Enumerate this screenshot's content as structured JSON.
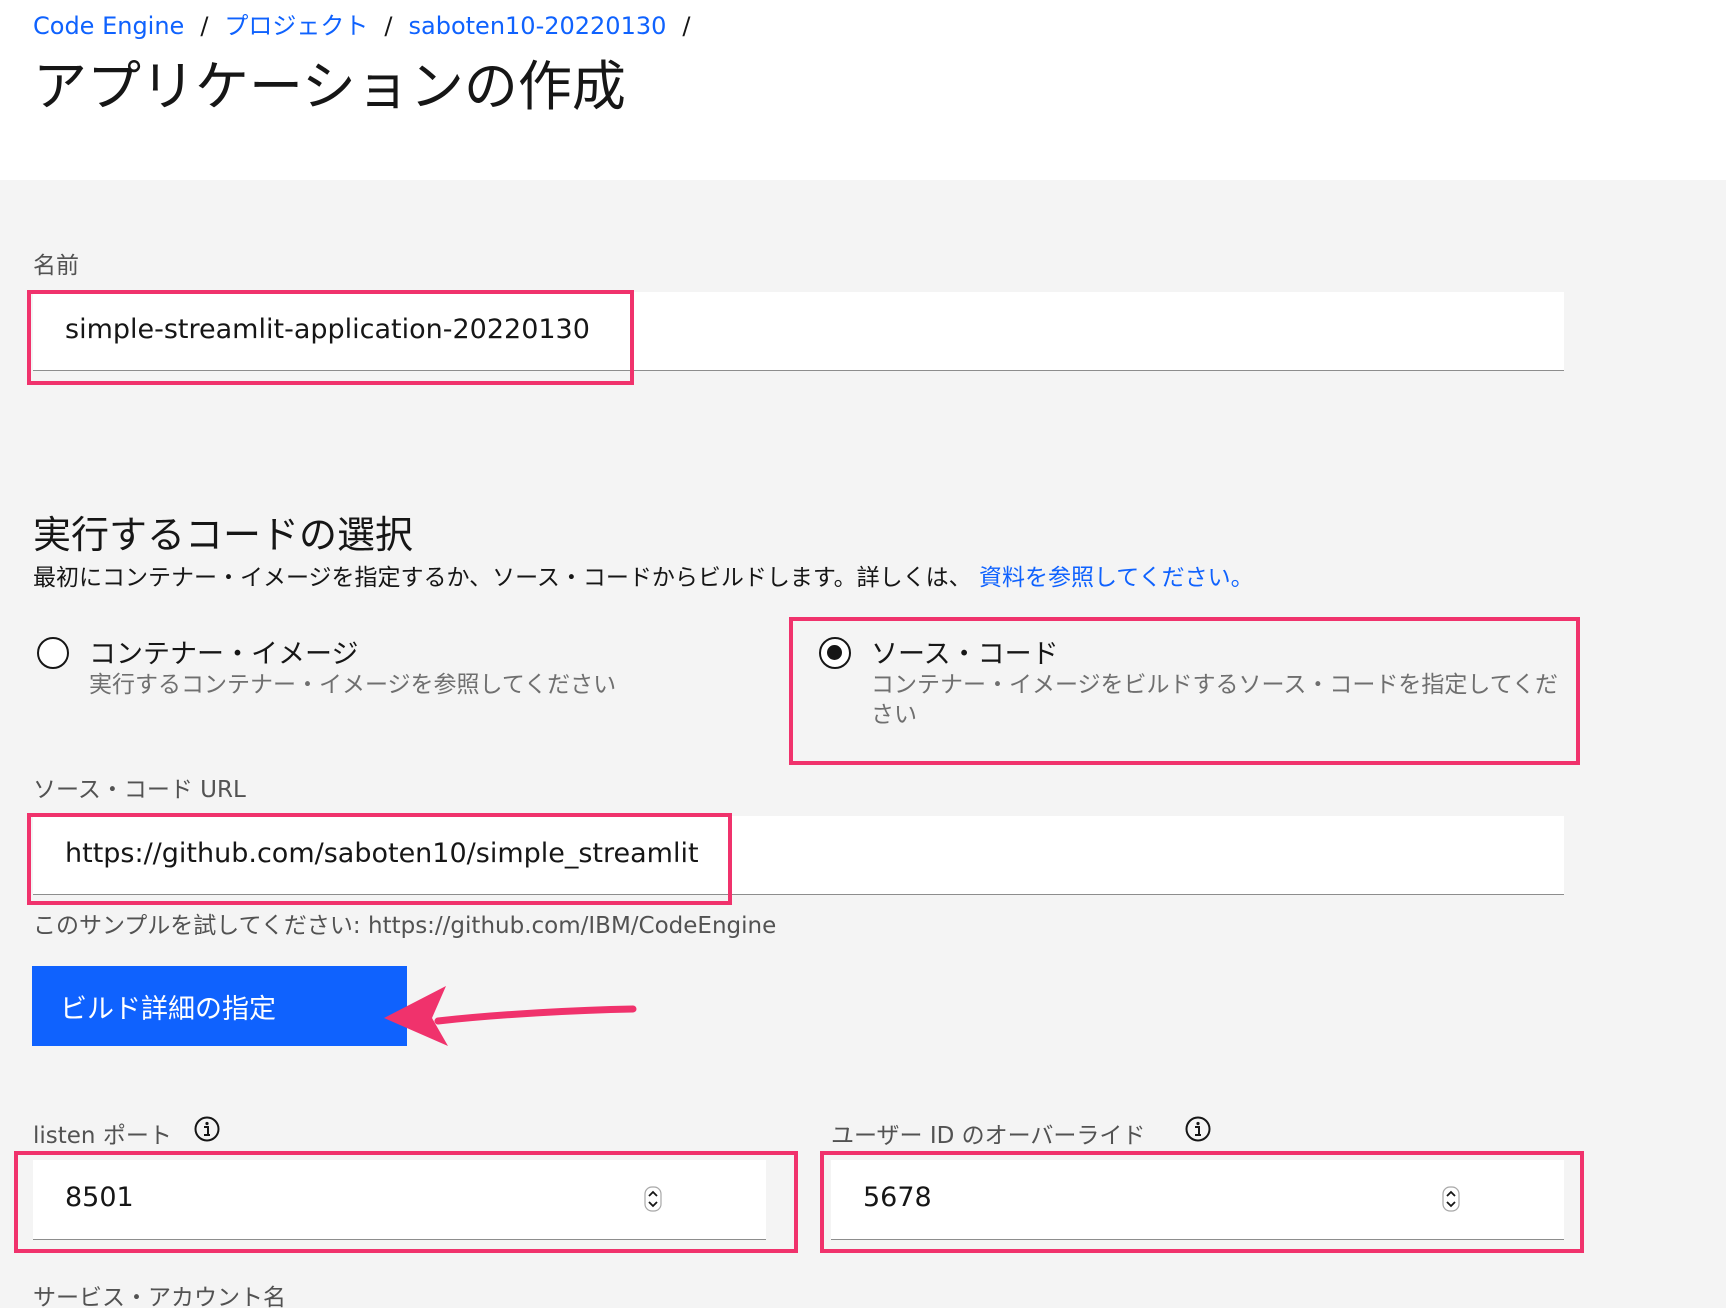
{
  "breadcrumb": {
    "items": [
      "Code Engine",
      "プロジェクト",
      "saboten10-20220130"
    ],
    "separator": "/"
  },
  "page_title": "アプリケーションの作成",
  "name_field": {
    "label": "名前",
    "value": "simple-streamlit-application-20220130"
  },
  "code_section": {
    "title": "実行するコードの選択",
    "description": "最初にコンテナー・イメージを指定するか、ソース・コードからビルドします。詳しくは、",
    "link_text": "資料を参照してください。"
  },
  "radio_options": [
    {
      "title": "コンテナー・イメージ",
      "description": "実行するコンテナー・イメージを参照してください",
      "selected": false
    },
    {
      "title": "ソース・コード",
      "description": "コンテナー・イメージをビルドするソース・コードを指定してください",
      "selected": true
    }
  ],
  "source_url_field": {
    "label": "ソース・コード URL",
    "value": "https://github.com/saboten10/simple_streamlit",
    "helper": "このサンプルを試してください: https://github.com/IBM/CodeEngine"
  },
  "build_button": {
    "label": "ビルド詳細の指定"
  },
  "listen_port": {
    "label": "listen ポート",
    "value": "8501"
  },
  "user_id_override": {
    "label": "ユーザー ID のオーバーライド",
    "value": "5678"
  },
  "service_account": {
    "label": "サービス・アカウント名"
  },
  "colors": {
    "accent": "#0f62fe",
    "annotation": "#f0326c",
    "background": "#f4f4f4"
  },
  "icons": [
    "info-icon",
    "spinner-icon",
    "arrow-annotation"
  ]
}
